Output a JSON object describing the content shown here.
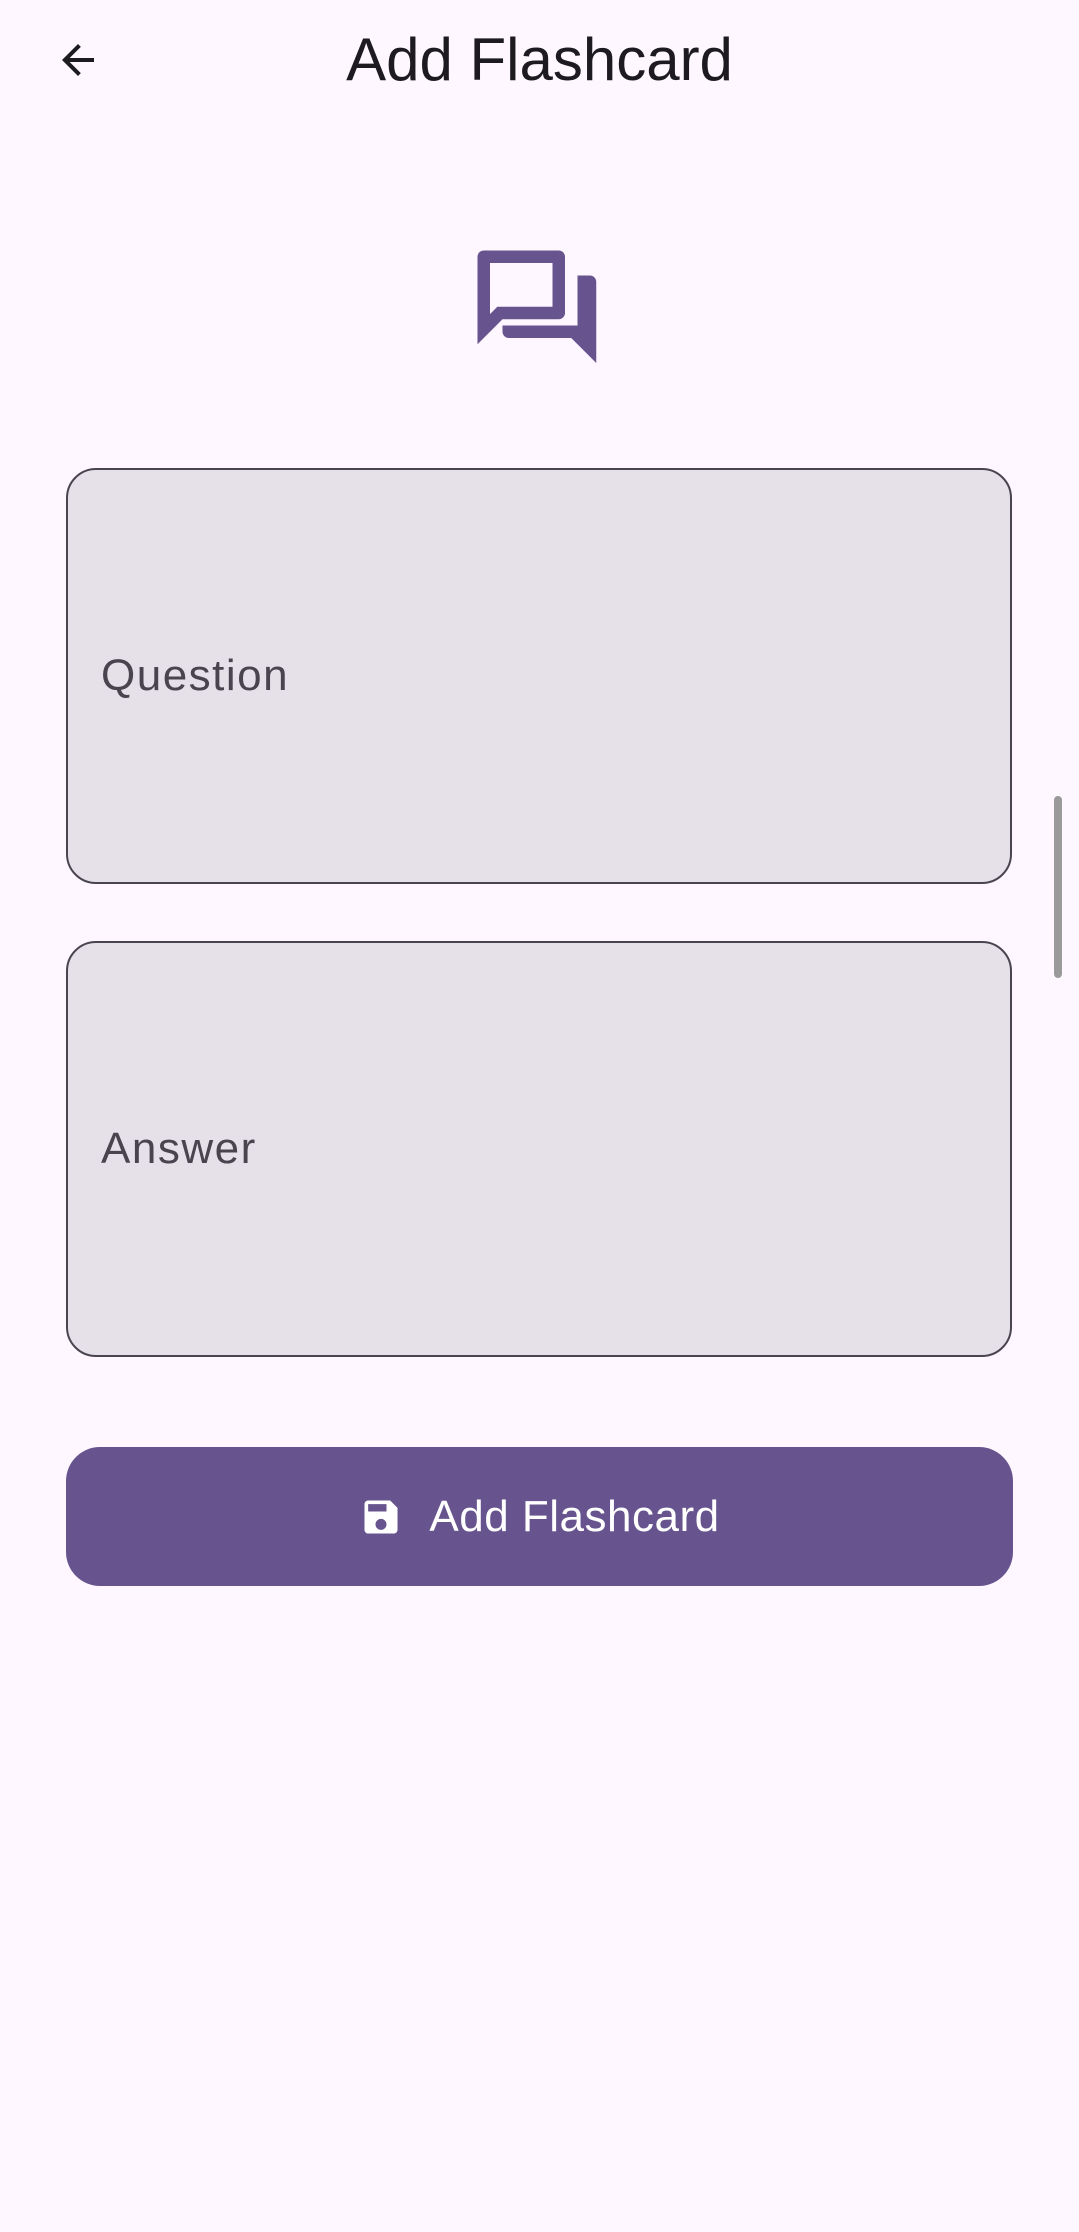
{
  "app_bar": {
    "title": "Add Flashcard",
    "back_icon": "arrow-back-icon"
  },
  "hero": {
    "icon": "forum-icon",
    "color": "#67548E"
  },
  "form": {
    "question_label": "Question",
    "answer_label": "Answer",
    "field_background": "#E6E0E9",
    "field_border": "#49454F"
  },
  "submit": {
    "label": "Add Flashcard",
    "icon": "save-icon",
    "background": "#67548E",
    "text_color": "#FFFFFF"
  },
  "theme": {
    "background": "#FEF7FF",
    "on_surface": "#1D1B20"
  }
}
